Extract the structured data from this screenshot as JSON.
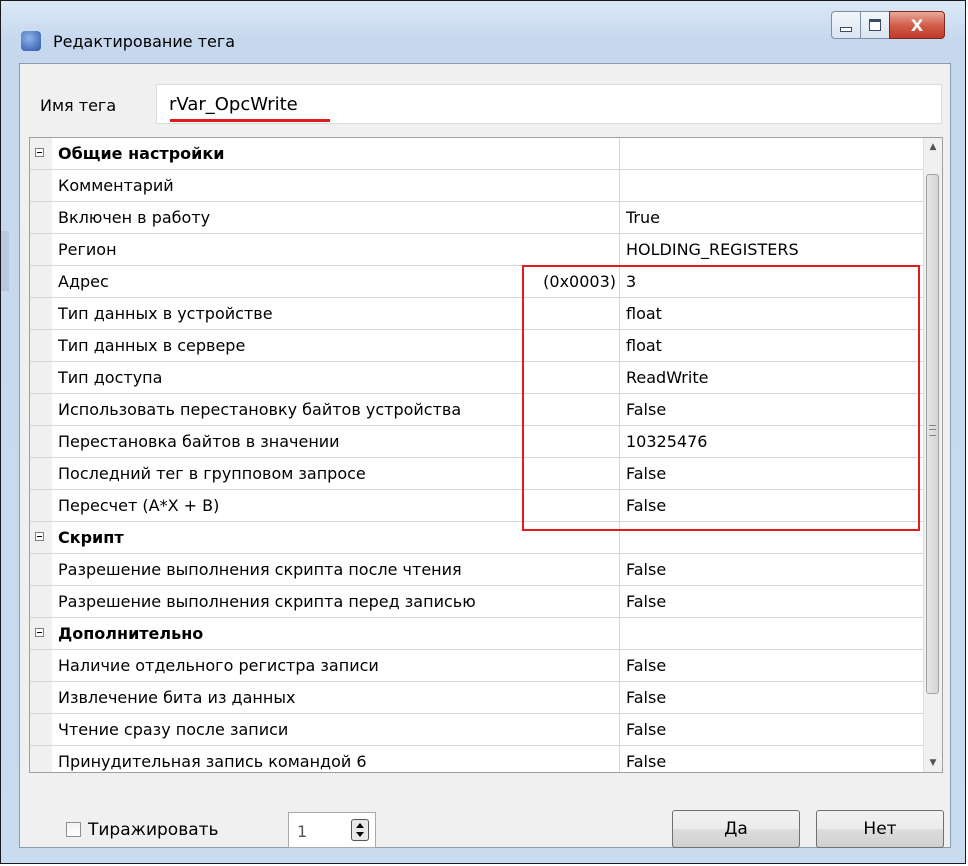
{
  "window": {
    "title": "Редактирование тега",
    "close_glyph": "X"
  },
  "tag_name": {
    "label": "Имя тега",
    "value": "rVar_OpcWrite"
  },
  "grid": {
    "rows": [
      {
        "kind": "category",
        "name": "Общие настройки",
        "value": ""
      },
      {
        "kind": "property",
        "name": "Комментарий",
        "value": ""
      },
      {
        "kind": "property",
        "name": "Включен в работу",
        "value": "True"
      },
      {
        "kind": "property",
        "name": "Регион",
        "value": "HOLDING_REGISTERS"
      },
      {
        "kind": "property",
        "name": "Адрес",
        "hint": "(0x0003)",
        "value": "3"
      },
      {
        "kind": "property",
        "name": "Тип данных в устройстве",
        "value": "float"
      },
      {
        "kind": "property",
        "name": "Тип данных в сервере",
        "value": "float"
      },
      {
        "kind": "property",
        "name": "Тип доступа",
        "value": "ReadWrite"
      },
      {
        "kind": "property",
        "name": "Использовать перестановку байтов устройства",
        "value": "False"
      },
      {
        "kind": "property",
        "name": "Перестановка байтов в значении",
        "value": "10325476"
      },
      {
        "kind": "property",
        "name": "Последний тег в групповом запросе",
        "value": "False"
      },
      {
        "kind": "property",
        "name": "Пересчет (A*X + B)",
        "value": "False"
      },
      {
        "kind": "category",
        "name": "Скрипт",
        "value": ""
      },
      {
        "kind": "property",
        "name": "Разрешение выполнения скрипта после чтения",
        "value": "False"
      },
      {
        "kind": "property",
        "name": "Разрешение выполнения скрипта перед записью",
        "value": "False"
      },
      {
        "kind": "category",
        "name": "Дополнительно",
        "value": ""
      },
      {
        "kind": "property",
        "name": "Наличие отдельного регистра записи",
        "value": "False"
      },
      {
        "kind": "property",
        "name": "Извлечение бита из данных",
        "value": "False"
      },
      {
        "kind": "property",
        "name": "Чтение сразу после записи",
        "value": "False"
      },
      {
        "kind": "property",
        "name": "Принудительная запись командой 6",
        "value": "False"
      }
    ]
  },
  "footer": {
    "replicate_label": "Тиражировать",
    "replicate_checked": false,
    "count_value": "1",
    "yes_label": "Да",
    "no_label": "Нет"
  },
  "colors": {
    "highlight": "#e21b1b"
  }
}
